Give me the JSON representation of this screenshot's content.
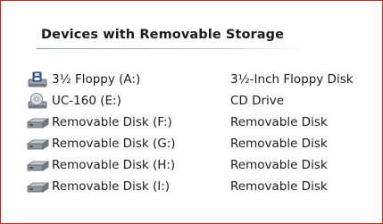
{
  "panel": {
    "group_title": "Devices with Removable Storage",
    "accent_color": "#c8251e",
    "devices": [
      {
        "name": "3½ Floppy (A:)",
        "type": "3½-Inch Floppy Disk",
        "icon": "floppy-drive-icon"
      },
      {
        "name": "UC-160 (E:)",
        "type": "CD Drive",
        "icon": "cd-drive-icon"
      },
      {
        "name": "Removable Disk (F:)",
        "type": "Removable Disk",
        "icon": "removable-disk-icon"
      },
      {
        "name": "Removable Disk (G:)",
        "type": "Removable Disk",
        "icon": "removable-disk-icon"
      },
      {
        "name": "Removable Disk (H:)",
        "type": "Removable Disk",
        "icon": "removable-disk-icon"
      },
      {
        "name": "Removable Disk (I:)",
        "type": "Removable Disk",
        "icon": "removable-disk-icon"
      }
    ]
  }
}
